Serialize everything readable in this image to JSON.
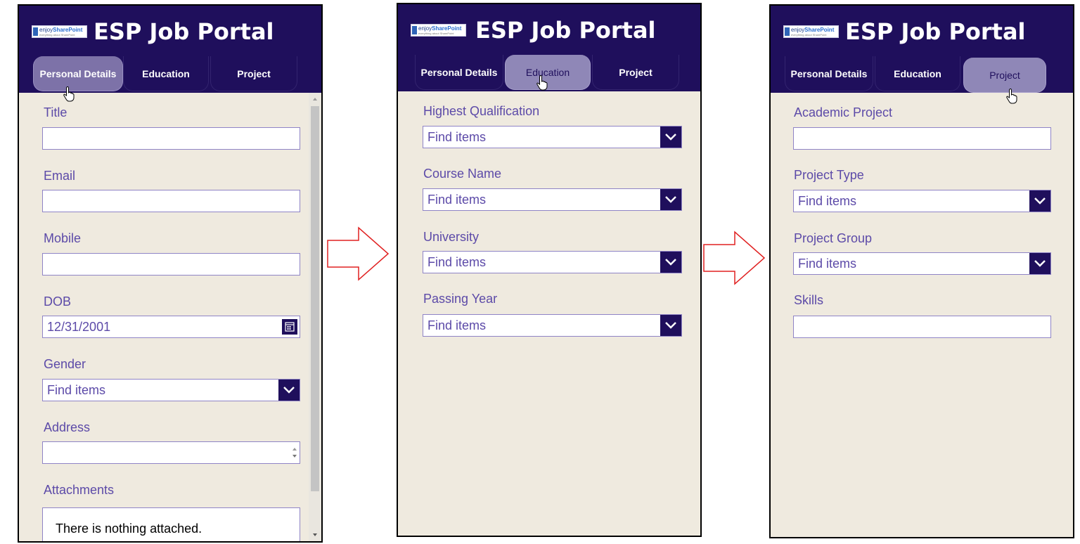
{
  "app": {
    "title": "ESP Job Portal",
    "logo": {
      "brand_prefix": "enjoy",
      "brand_name": "SharePoint",
      "tagline": "everything about SharePoint"
    }
  },
  "tabs": {
    "personal": "Personal Details",
    "education": "Education",
    "project": "Project"
  },
  "personal": {
    "title_label": "Title",
    "email_label": "Email",
    "mobile_label": "Mobile",
    "dob_label": "DOB",
    "dob_value": "12/31/2001",
    "gender_label": "Gender",
    "gender_placeholder": "Find items",
    "address_label": "Address",
    "attachments_label": "Attachments",
    "attachments_empty": "There is nothing attached."
  },
  "education": {
    "qualification_label": "Highest Qualification",
    "qualification_placeholder": "Find items",
    "course_label": "Course Name",
    "course_placeholder": "Find items",
    "university_label": "University",
    "university_placeholder": "Find items",
    "passing_year_label": "Passing Year",
    "passing_year_placeholder": "Find items"
  },
  "project": {
    "academic_label": "Academic Project",
    "type_label": "Project Type",
    "type_placeholder": "Find items",
    "group_label": "Project Group",
    "group_placeholder": "Find items",
    "skills_label": "Skills"
  },
  "colors": {
    "header": "#1f0f5c",
    "form_background": "#efeadf",
    "label": "#5c4aa8",
    "selected_tab": "#7d72a8",
    "flow_arrow": "#e02020"
  },
  "icons": [
    "hand-cursor-icon",
    "calendar-icon",
    "chevron-down-icon",
    "right-arrow-icon"
  ]
}
